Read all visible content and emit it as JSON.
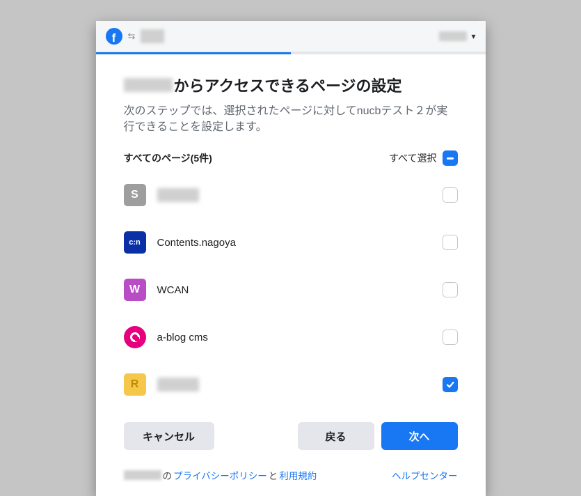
{
  "header": {
    "caret": "▾"
  },
  "progress_pct": 50,
  "title_suffix": "からアクセスできるページの設定",
  "subtitle": "次のステップでは、選択されたページに対してnucbテスト２が実行できることを設定します。",
  "list": {
    "header_label": "すべてのページ(5件)",
    "select_all_label": "すべて選択",
    "items": [
      {
        "name": "",
        "obscured": true,
        "checked": false,
        "letter": "S",
        "icon_class": "ic-gray"
      },
      {
        "name": "Contents.nagoya",
        "obscured": false,
        "checked": false,
        "letter": "c:n",
        "icon_class": "ic-blue"
      },
      {
        "name": "WCAN",
        "obscured": false,
        "checked": false,
        "letter": "W",
        "icon_class": "ic-purple"
      },
      {
        "name": "a-blog cms",
        "obscured": false,
        "checked": false,
        "letter": "",
        "icon_class": "ic-pink"
      },
      {
        "name": "",
        "obscured": true,
        "checked": true,
        "letter": "R",
        "icon_class": "ic-yellow"
      }
    ]
  },
  "buttons": {
    "cancel": "キャンセル",
    "back": "戻る",
    "next": "次へ"
  },
  "footer": {
    "mid1": "の",
    "privacy": "プライバシーポリシー",
    "mid2": "と",
    "terms": "利用規約",
    "help": "ヘルプセンター"
  }
}
